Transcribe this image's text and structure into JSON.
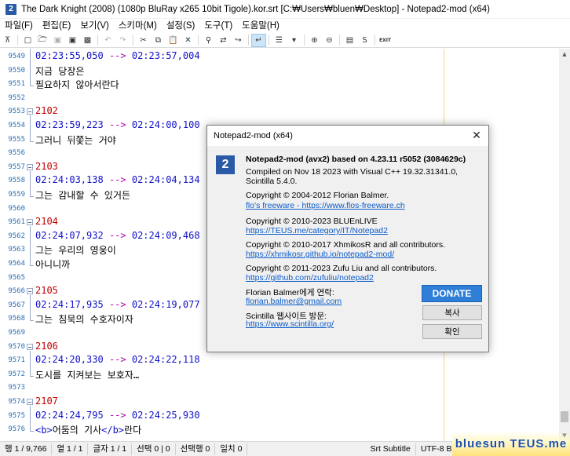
{
  "window": {
    "title": "The Dark Knight (2008) (1080p BluRay x265 10bit Tigole).kor.srt [C:₩Users₩bluen₩Desktop] - Notepad2-mod (x64)"
  },
  "menu": [
    "파일(F)",
    "편집(E)",
    "보기(V)",
    "스키마(M)",
    "설정(S)",
    "도구(T)",
    "도움말(H)"
  ],
  "toolbar": {
    "icons": [
      "expand-icon",
      "new-file-icon",
      "open-icon",
      "save-disabled-icon",
      "save-icon",
      "save-as-icon",
      "undo-icon",
      "redo-icon",
      "cut-icon",
      "copy-icon",
      "paste-icon",
      "delete-icon",
      "find-icon",
      "replace-icon",
      "goto-icon",
      "wordwrap-icon",
      "bookmark-icon",
      "bookmark-menu-icon",
      "zoom-in-icon",
      "zoom-out-icon",
      "schema-icon",
      "settings-icon",
      "exit-icon"
    ],
    "exit_label": "EXIT",
    "s_label": "S"
  },
  "editor": {
    "lines": [
      {
        "n": "9549",
        "kind": "time",
        "start": "02:23:55,050",
        "arrow": "-->",
        "end": "02:23:57,004"
      },
      {
        "n": "9550",
        "kind": "text",
        "text": "지금 당장은"
      },
      {
        "n": "9551",
        "kind": "text",
        "text": "필요하지 않아서란다"
      },
      {
        "n": "9552",
        "kind": "blank"
      },
      {
        "n": "9553",
        "kind": "num",
        "text": "2102"
      },
      {
        "n": "9554",
        "kind": "time",
        "start": "02:23:59,223",
        "arrow": "-->",
        "end": "02:24:00,100"
      },
      {
        "n": "9555",
        "kind": "text",
        "text": "그러니 뒤쫓는 거야"
      },
      {
        "n": "9556",
        "kind": "blank"
      },
      {
        "n": "9557",
        "kind": "num",
        "text": "2103"
      },
      {
        "n": "9558",
        "kind": "time",
        "start": "02:24:03,138",
        "arrow": "-->",
        "end": "02:24:04,134"
      },
      {
        "n": "9559",
        "kind": "text",
        "text": "그는 감내할 수 있거든"
      },
      {
        "n": "9560",
        "kind": "blank"
      },
      {
        "n": "9561",
        "kind": "num",
        "text": "2104"
      },
      {
        "n": "9562",
        "kind": "time",
        "start": "02:24:07,932",
        "arrow": "-->",
        "end": "02:24:09,468"
      },
      {
        "n": "9563",
        "kind": "text",
        "text": "그는 우리의 영웅이"
      },
      {
        "n": "9564",
        "kind": "text",
        "text": "아니니까"
      },
      {
        "n": "9565",
        "kind": "blank"
      },
      {
        "n": "9566",
        "kind": "num",
        "text": "2105"
      },
      {
        "n": "9567",
        "kind": "time",
        "start": "02:24:17,935",
        "arrow": "-->",
        "end": "02:24:19,077"
      },
      {
        "n": "9568",
        "kind": "text",
        "text": "그는 침묵의 수호자이자"
      },
      {
        "n": "9569",
        "kind": "blank"
      },
      {
        "n": "9570",
        "kind": "num",
        "text": "2106"
      },
      {
        "n": "9571",
        "kind": "time",
        "start": "02:24:20,330",
        "arrow": "-->",
        "end": "02:24:22,118"
      },
      {
        "n": "9572",
        "kind": "text",
        "text": "도시를 지켜보는 보호자…"
      },
      {
        "n": "9573",
        "kind": "blank"
      },
      {
        "n": "9574",
        "kind": "num",
        "text": "2107"
      },
      {
        "n": "9575",
        "kind": "time",
        "start": "02:24:24,795",
        "arrow": "-->",
        "end": "02:24:25,930"
      },
      {
        "n": "9576",
        "kind": "tagged",
        "open": "<b>",
        "text": "어둠의 기사",
        "close": "</b>",
        "rest": "란다"
      }
    ]
  },
  "statusbar": {
    "cells": [
      "행 1 / 9,766",
      "열 1 / 1",
      "글자 1 / 1",
      "선택 0 | 0",
      "선택행 0",
      "일치 0"
    ],
    "right_cells": [
      "Srt Subtitle",
      "UTF-8 BOM"
    ],
    "watermark": "bluesun TEUS.me"
  },
  "dialog": {
    "title": "Notepad2-mod (x64)",
    "heading": "Notepad2-mod (avx2) based on 4.23.11 r5052 (3084629c)",
    "compiled_1": "Compiled on Nov 18 2023 with Visual C++ 19.32.31341.0,",
    "compiled_2": "Scintilla 5.4.0.",
    "copy1": "Copyright © 2004-2012 Florian Balmer.",
    "link1": "flo's freeware - https://www.flos-freeware.ch",
    "copy2": "Copyright © 2010-2023 BLUEnLIVE",
    "link2": "https://TEUS.me/category/IT/Notepad2",
    "copy3": "Copyright © 2010-2017 XhmikosR and all contributors.",
    "link3": "https://xhmikosr.github.io/notepad2-mod/",
    "copy4": "Copyright © 2011-2023 Zufu Liu and all contributors.",
    "link4": "https://github.com/zufuliu/notepad2",
    "contact_label": "Florian Balmer에게 연락:",
    "contact_link": "florian.balmer@gmail.com",
    "scintilla_label": "Scintilla 웹사이트 방문:",
    "scintilla_link": "https://www.scintilla.org/",
    "donate": "DONATE",
    "copy_button": "복사",
    "ok_button": "확인",
    "close_glyph": "✕",
    "logo_text": "2"
  },
  "colors": {
    "subtitle_number": "#c00000",
    "timestamp": "#1010c8",
    "arrow": "#b000b0",
    "line_number": "#2b6fb6",
    "donate": "#2f7fd8",
    "link": "#0b5cc9"
  }
}
